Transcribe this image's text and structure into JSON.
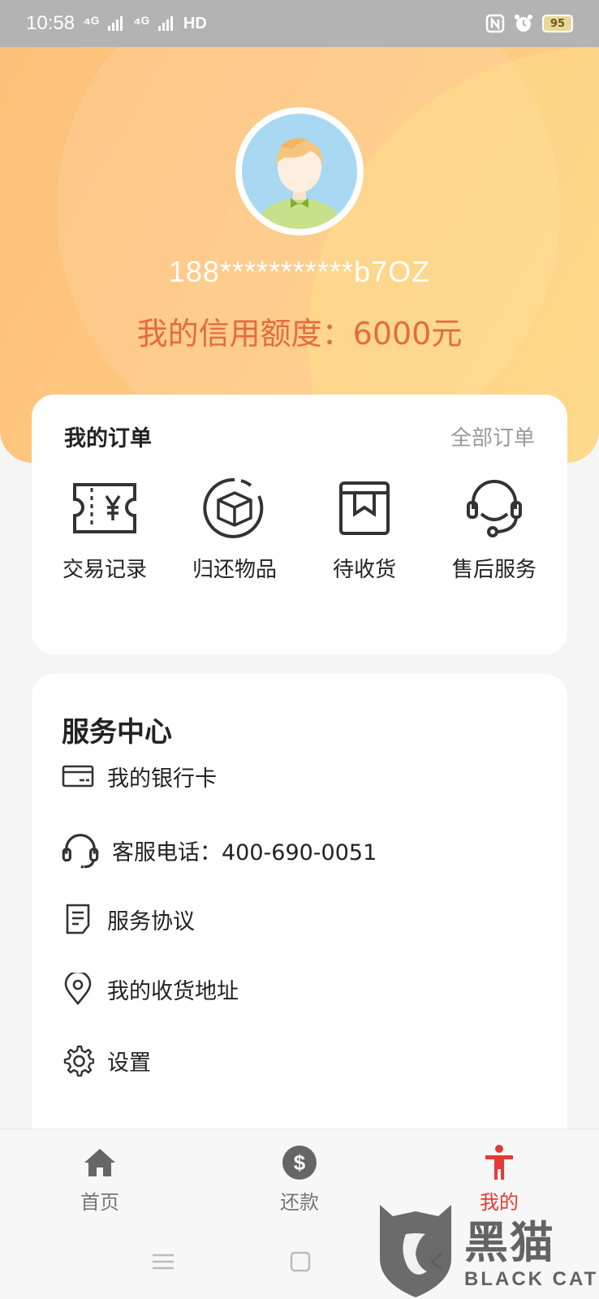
{
  "status_bar": {
    "time": "10:58",
    "signal_1": "⁴ᴳ",
    "signal_2": "⁴ᴳ",
    "hd": "HD",
    "battery": "95"
  },
  "profile": {
    "phone": "188***********b7OZ",
    "credit_text": "我的信用额度：6000元"
  },
  "orders": {
    "title": "我的订单",
    "all_link": "全部订单",
    "items": [
      {
        "label": "交易记录",
        "icon": "ticket-yen-icon"
      },
      {
        "label": "归还物品",
        "icon": "box-return-icon"
      },
      {
        "label": "待收货",
        "icon": "package-icon"
      },
      {
        "label": "售后服务",
        "icon": "headset-icon"
      }
    ]
  },
  "service": {
    "title": "服务中心",
    "rows": [
      {
        "label": "我的银行卡",
        "icon": "bank-card-icon"
      },
      {
        "label": "客服电话：400-690-0051",
        "icon": "headphone-icon"
      },
      {
        "label": "服务协议",
        "icon": "document-icon"
      },
      {
        "label": "我的收货地址",
        "icon": "location-pin-icon"
      },
      {
        "label": "设置",
        "icon": "gear-icon"
      }
    ]
  },
  "tabs": [
    {
      "label": "首页",
      "icon": "home-icon",
      "active": false
    },
    {
      "label": "还款",
      "icon": "dollar-circle-icon",
      "active": false
    },
    {
      "label": "我的",
      "icon": "person-icon",
      "active": true
    }
  ],
  "watermark": {
    "main": "黑猫",
    "sub": "BLACK CAT"
  },
  "colors": {
    "header_gradient_start": "#fdc07a",
    "header_gradient_end": "#fed28b",
    "credit_text": "#e36d3a",
    "active_tab": "#e53935",
    "inactive_tab": "#777777"
  }
}
